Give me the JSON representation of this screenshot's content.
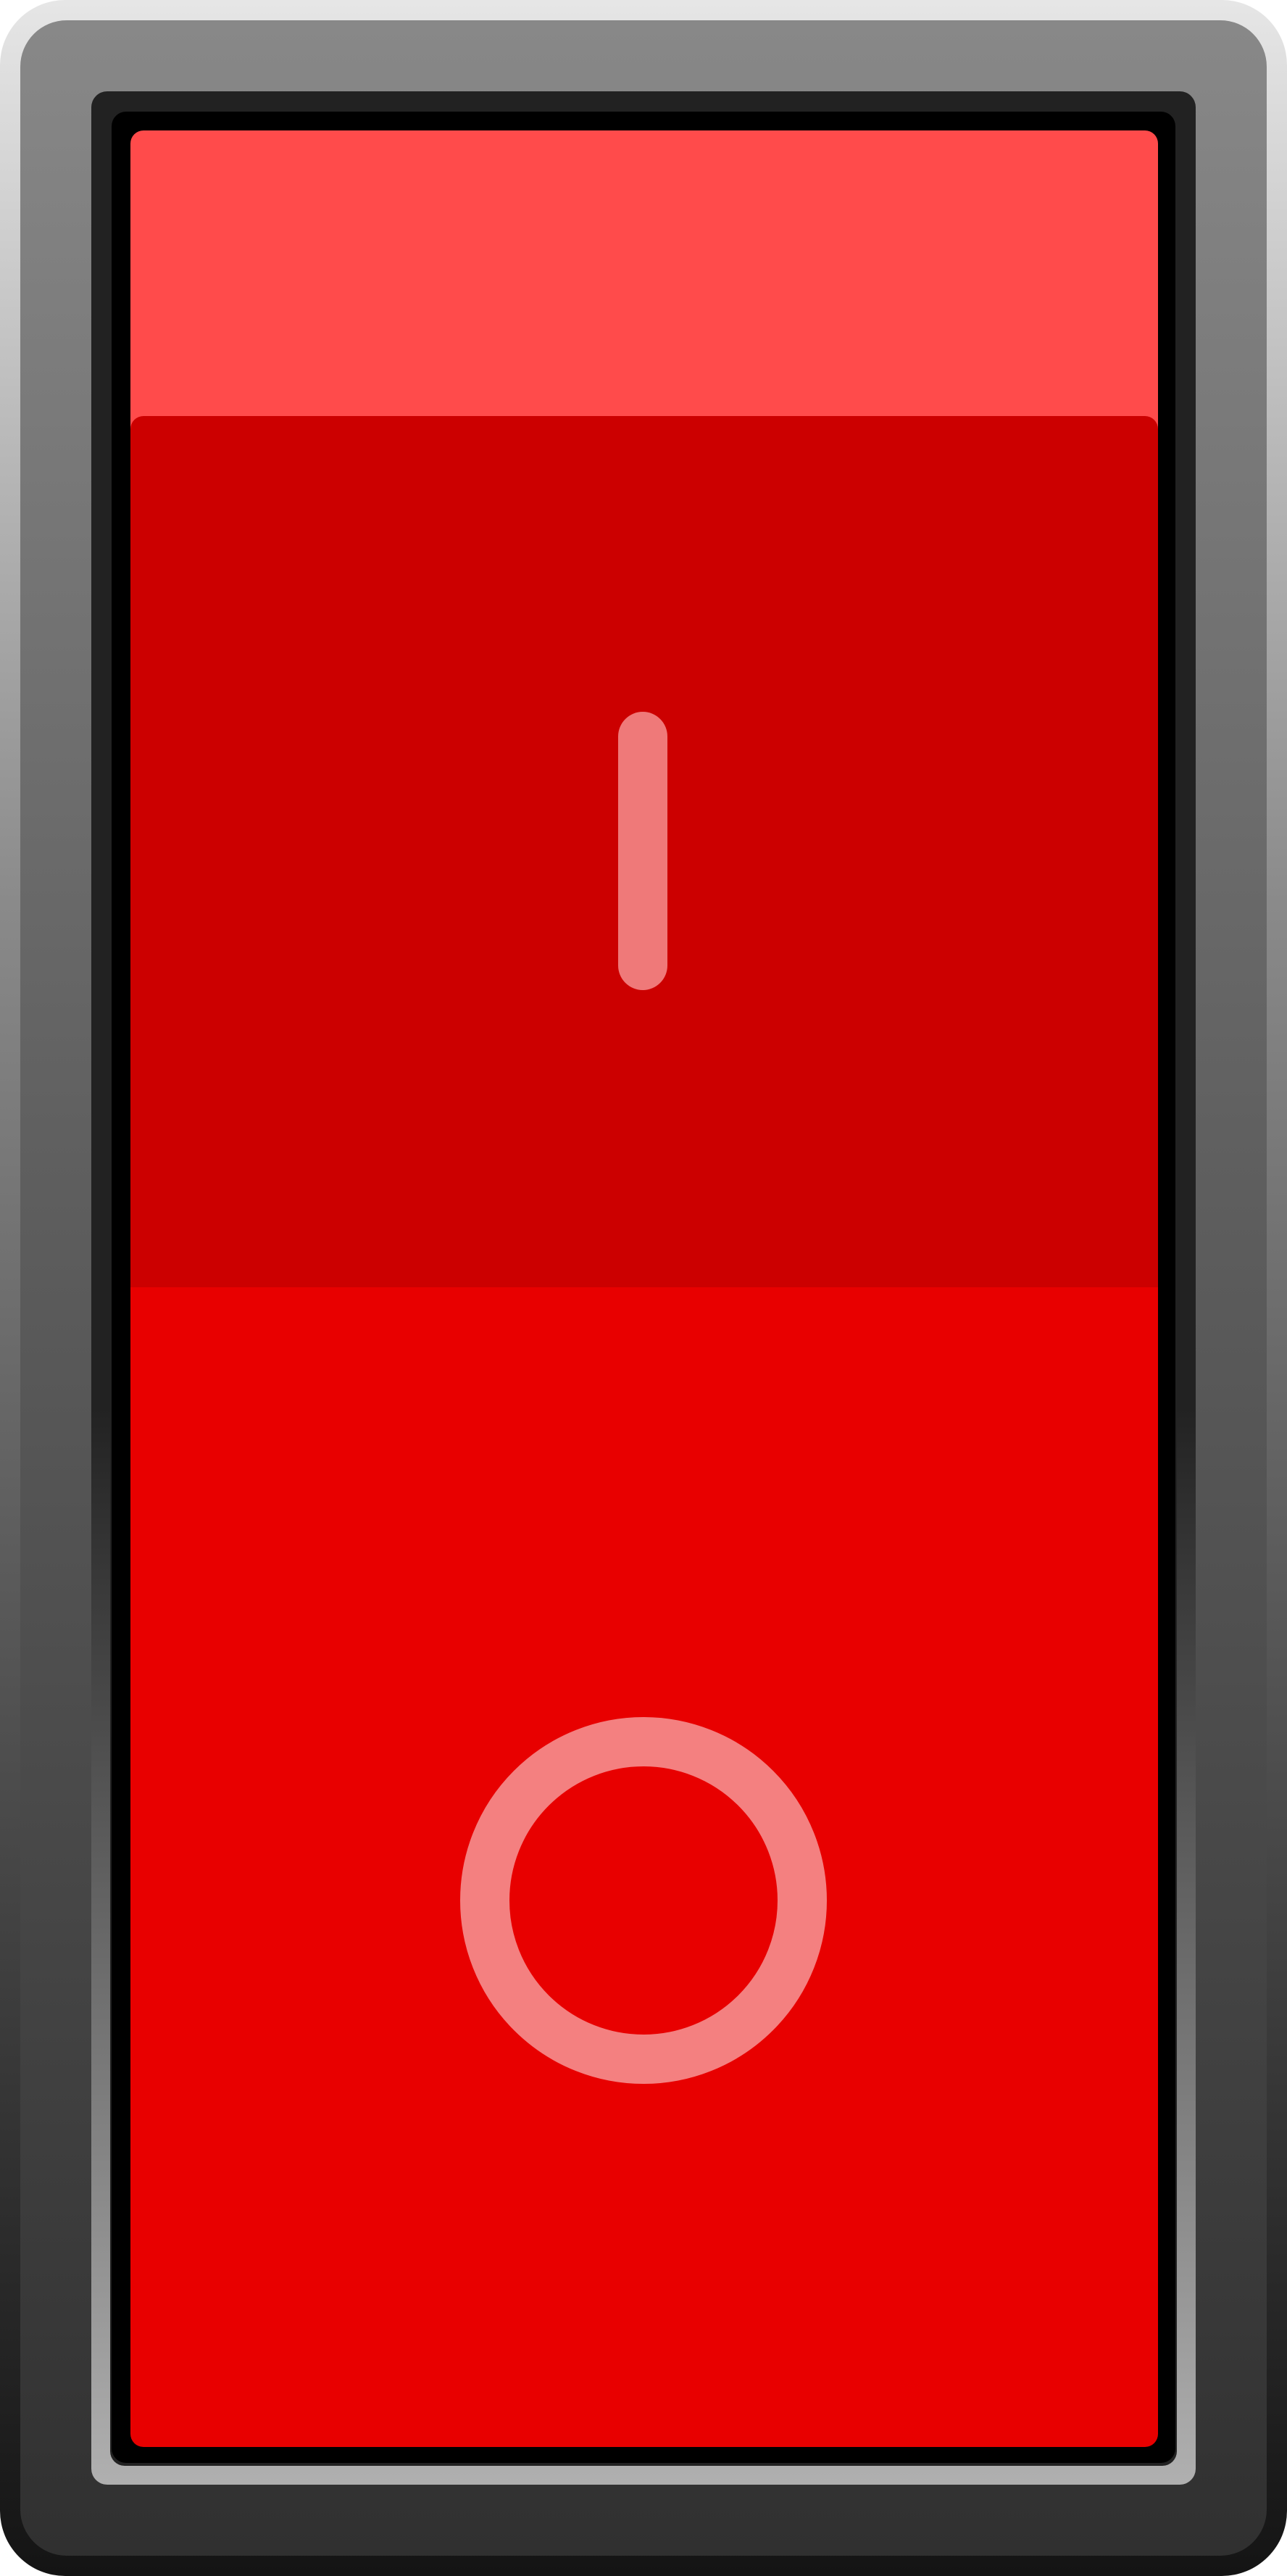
{
  "rocker_switch": {
    "on_symbol": "I",
    "off_symbol": "O",
    "on_symbol_icon": "power-on-line-icon",
    "off_symbol_icon": "power-off-circle-icon",
    "state": "on",
    "colors": {
      "housing_top": "#878787",
      "housing_bottom": "#303030",
      "bezel": "#222222",
      "rocker_top_face": "#ff4b4b",
      "rocker_pressed_face": "#cc0000",
      "rocker_lower_face": "#e80000",
      "symbol": "#f08080"
    }
  }
}
